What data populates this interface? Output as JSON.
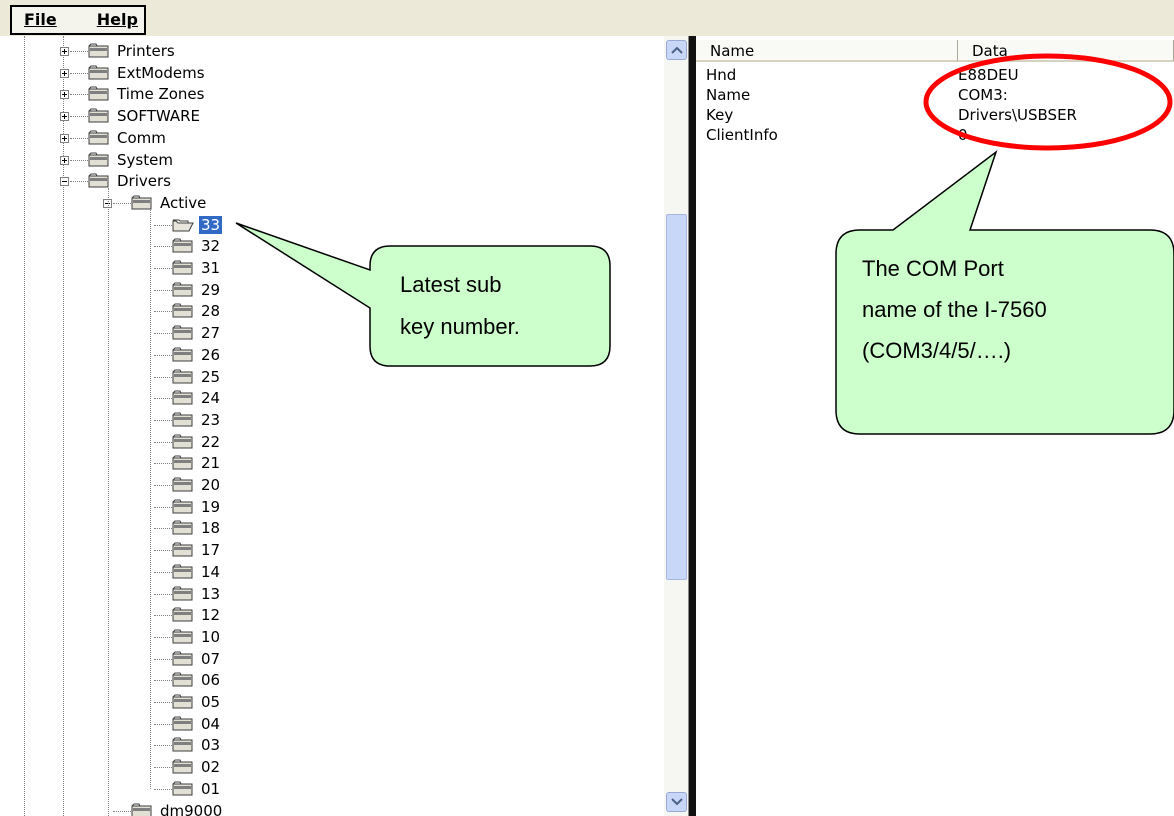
{
  "menu": {
    "file_label": "File",
    "help_label": "Help"
  },
  "tree": {
    "top_items": [
      "Printers",
      "ExtModems",
      "Time Zones",
      "SOFTWARE",
      "Comm",
      "System",
      "Drivers"
    ],
    "active_label": "Active",
    "active_children": [
      "33",
      "32",
      "31",
      "29",
      "28",
      "27",
      "26",
      "25",
      "24",
      "23",
      "22",
      "21",
      "20",
      "19",
      "18",
      "17",
      "14",
      "13",
      "12",
      "10",
      "07",
      "06",
      "05",
      "04",
      "03",
      "02",
      "01"
    ],
    "selected": "33",
    "bottom_item": "dm9000"
  },
  "list": {
    "headers": {
      "name": "Name",
      "data": "Data"
    },
    "rows": [
      {
        "name": "Hnd",
        "data": "E88DEU"
      },
      {
        "name": "Name",
        "data": "COM3:"
      },
      {
        "name": "Key",
        "data": "Drivers\\USBSER"
      },
      {
        "name": "ClientInfo",
        "data": "0"
      }
    ]
  },
  "callouts": {
    "left": [
      "Latest sub",
      "key number."
    ],
    "right": [
      "The COM Port",
      "name of the I-7560",
      "(COM3/4/5/….)"
    ]
  },
  "colors": {
    "callout_fill": "#ccffcc",
    "highlight_ellipse": "#ff0000",
    "selection": "#316ac5",
    "scroll_thumb": "#c8d6f8"
  }
}
